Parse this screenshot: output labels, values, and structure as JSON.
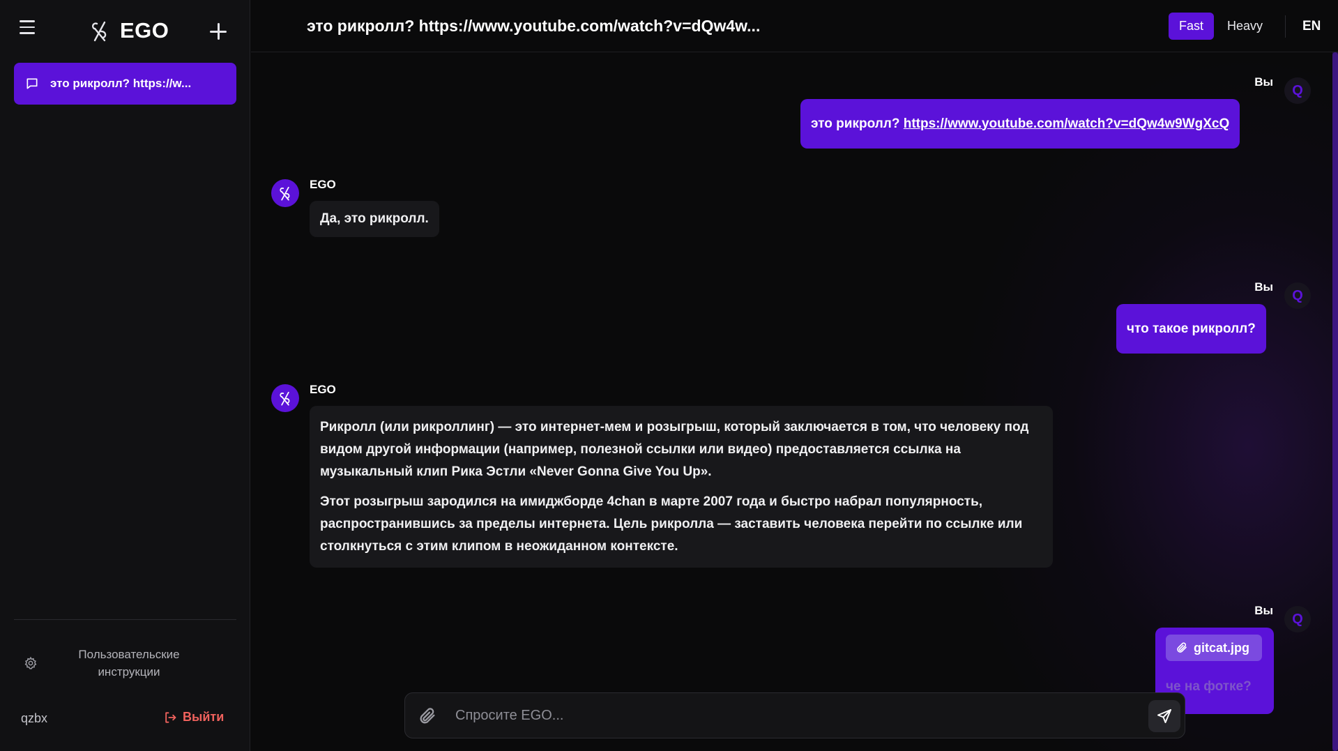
{
  "app": {
    "name": "EGO",
    "accent_color": "#5b12d9"
  },
  "sidebar": {
    "chats": [
      {
        "label": "это рикролл? https://w...",
        "icon": "message-square-icon",
        "active": true
      }
    ],
    "instructions_label": "Пользовательские инструкции",
    "username": "qzbx",
    "logout_label": "Выйти"
  },
  "header": {
    "chat_title": "это рикролл? https://www.youtube.com/watch?v=dQw4w...",
    "modes": {
      "fast": "Fast",
      "heavy": "Heavy",
      "selected": "Fast"
    },
    "language": "EN"
  },
  "messages": [
    {
      "role": "user",
      "author": "Вы",
      "avatar": "Q",
      "text": "это рикролл? ",
      "link": "https://www.youtube.com/watch?v=dQw4w9WgXcQ"
    },
    {
      "role": "assistant",
      "author": "EGO",
      "paragraphs": [
        "Да, это рикролл."
      ]
    },
    {
      "role": "user",
      "author": "Вы",
      "avatar": "Q",
      "text": "что такое рикролл?"
    },
    {
      "role": "assistant",
      "author": "EGO",
      "paragraphs": [
        "Рикролл (или рикроллинг) — это интернет-мем и розыгрыш, который заключается в том, что человеку под видом другой информации (например, полезной ссылки или видео) предоставляется ссылка на музыкальный клип Рика Эстли «Never Gonna Give You Up».",
        "Этот розыгрыш зародился на имиджборде 4chan в марте 2007 года и быстро набрал популярность, распространившись за пределы интернета. Цель рикролла — заставить человека перейти по ссылке или столкнуться с этим клипом в неожиданном контексте."
      ]
    },
    {
      "role": "user",
      "author": "Вы",
      "avatar": "Q",
      "attachment": "gitcat.jpg",
      "text": "че на фотке?"
    }
  ],
  "composer": {
    "placeholder": "Спросите EGO...",
    "value": ""
  }
}
